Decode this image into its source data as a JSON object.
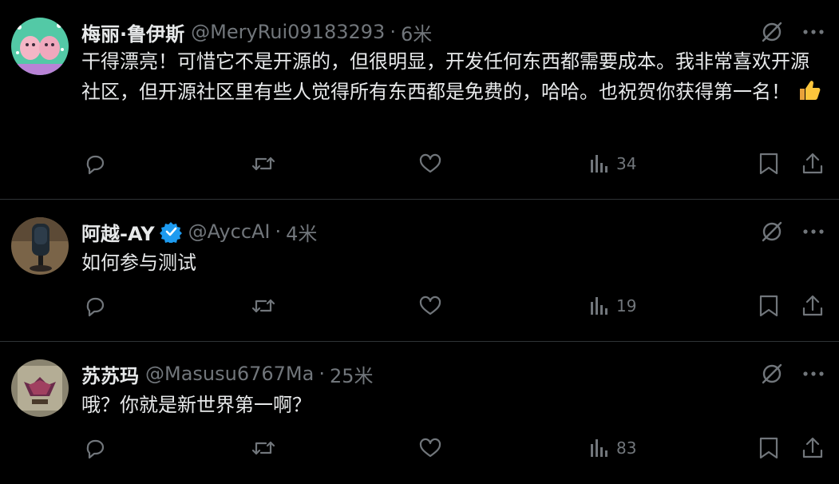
{
  "tweets": [
    {
      "name": "梅丽·鲁伊斯",
      "handle": "@MeryRui09183293",
      "dot": "·",
      "time": "6米",
      "text": "干得漂亮！可惜它不是开源的，但很明显，开发任何东西都需要成本。我非常喜欢开源社区，但开源社区里有些人觉得所有东西都是免费的，哈哈。也祝贺你获得第一名！",
      "views": "34",
      "verified": false
    },
    {
      "name": "阿越-AY",
      "handle": "@AyccAI",
      "dot": "·",
      "time": "4米",
      "text": "如何参与测试",
      "views": "19",
      "verified": true
    },
    {
      "name": "苏苏玛",
      "handle": "@Masusu6767Ma",
      "dot": "·",
      "time": "25米",
      "text": "哦？你就是新世界第一啊？",
      "views": "83",
      "verified": false
    }
  ],
  "icons": {
    "grok": "grok-slash-icon",
    "more": "more-dots-icon",
    "reply": "reply-icon",
    "retweet": "retweet-icon",
    "like": "like-icon",
    "views": "views-bar-icon",
    "bookmark": "bookmark-icon",
    "share": "share-icon"
  },
  "colors": {
    "background": "#000000",
    "text": "#e7e9ea",
    "muted": "#71767b",
    "verified": "#1d9bf0",
    "divider": "#2f3336"
  }
}
